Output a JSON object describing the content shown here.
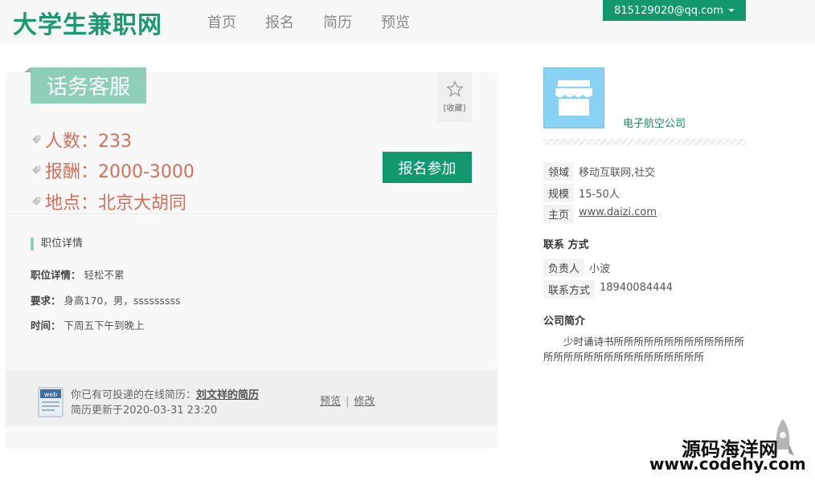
{
  "header": {
    "logo": "大学生兼职网",
    "nav": [
      "首页",
      "报名",
      "简历",
      "预览"
    ],
    "user_email": "815129020@qq.com"
  },
  "job": {
    "title": "话务客服",
    "favorite_label": "[收藏]",
    "count": "人数：233",
    "pay": "报酬：2000-3000",
    "location": "地点：北京大胡同",
    "signup_label": "报名参加"
  },
  "detail": {
    "section_title": "职位详情",
    "desc_label": "职位详情：",
    "desc_value": "轻松不累",
    "req_label": "要求：",
    "req_value": "身高170，男，sssssssss",
    "time_label": "时间：",
    "time_value": "下周五下午到晚上"
  },
  "resume": {
    "text_prefix": "你已有可投递的在线简历：",
    "resume_name": "刘文祥的简历",
    "updated": "简历更新于2020-03-31 23:20",
    "preview_link": "预览",
    "separator": "|",
    "edit_link": "修改",
    "icon_label": "web"
  },
  "company": {
    "name": "电子航空公司",
    "field_label": "领域",
    "field_value": "移动互联网,社交",
    "scale_label": "规模",
    "scale_value": "15-50人",
    "home_label": "主页",
    "home_value": "www.daizi.com",
    "contact_head": "联系 方式",
    "person_label": "负责人",
    "person_value": "小波",
    "phone_label": "联系方式",
    "phone_value": "18940084444",
    "intro_head": "公司简介",
    "intro": "少时诵诗书所所所所所所所所所所所所所所所所所所所所所所所所所所所所所"
  },
  "watermark": {
    "line1": "源码海洋网",
    "line2": "www.codehy.com"
  },
  "colors": {
    "brand_green": "#12976f",
    "tag_green": "#8fcfba",
    "info_orange": "#d4705a",
    "shop_blue": "#8ad2f3"
  }
}
